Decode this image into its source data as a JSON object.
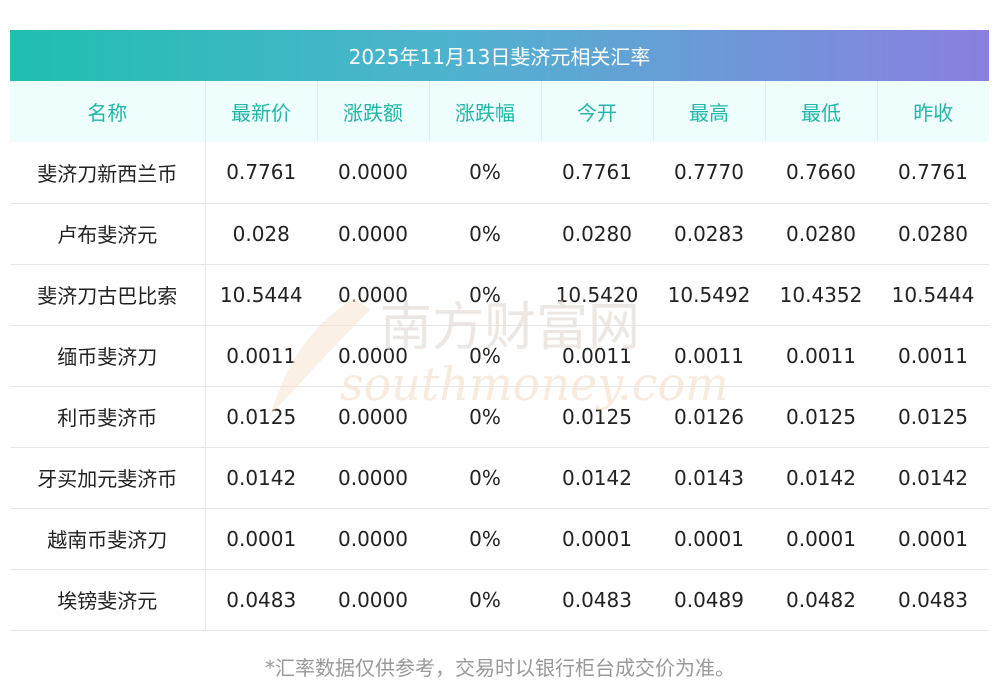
{
  "title": "2025年11月13日斐济元相关汇率",
  "headers": [
    "名称",
    "最新价",
    "涨跌额",
    "涨跌幅",
    "今开",
    "最高",
    "最低",
    "昨收"
  ],
  "rows": [
    [
      "斐济刀新西兰币",
      "0.7761",
      "0.0000",
      "0%",
      "0.7761",
      "0.7770",
      "0.7660",
      "0.7761"
    ],
    [
      "卢布斐济元",
      "0.028",
      "0.0000",
      "0%",
      "0.0280",
      "0.0283",
      "0.0280",
      "0.0280"
    ],
    [
      "斐济刀古巴比索",
      "10.5444",
      "0.0000",
      "0%",
      "10.5420",
      "10.5492",
      "10.4352",
      "10.5444"
    ],
    [
      "缅币斐济刀",
      "0.0011",
      "0.0000",
      "0%",
      "0.0011",
      "0.0011",
      "0.0011",
      "0.0011"
    ],
    [
      "利币斐济币",
      "0.0125",
      "0.0000",
      "0%",
      "0.0125",
      "0.0126",
      "0.0125",
      "0.0125"
    ],
    [
      "牙买加元斐济币",
      "0.0142",
      "0.0000",
      "0%",
      "0.0142",
      "0.0143",
      "0.0142",
      "0.0142"
    ],
    [
      "越南币斐济刀",
      "0.0001",
      "0.0000",
      "0%",
      "0.0001",
      "0.0001",
      "0.0001",
      "0.0001"
    ],
    [
      "埃镑斐济元",
      "0.0483",
      "0.0000",
      "0%",
      "0.0483",
      "0.0489",
      "0.0482",
      "0.0483"
    ]
  ],
  "watermark": {
    "cn": "南方财富网",
    "en": "southmoney.com"
  },
  "note": "*汇率数据仅供参考，交易时以银行柜台成交价为准。",
  "colors": {
    "header_text": "#22b6a8",
    "header_bg": "#eefefd",
    "title_gradient_start": "#1fbfb0",
    "title_gradient_end": "#8a7fe0",
    "watermark": "#f3d6b8"
  }
}
